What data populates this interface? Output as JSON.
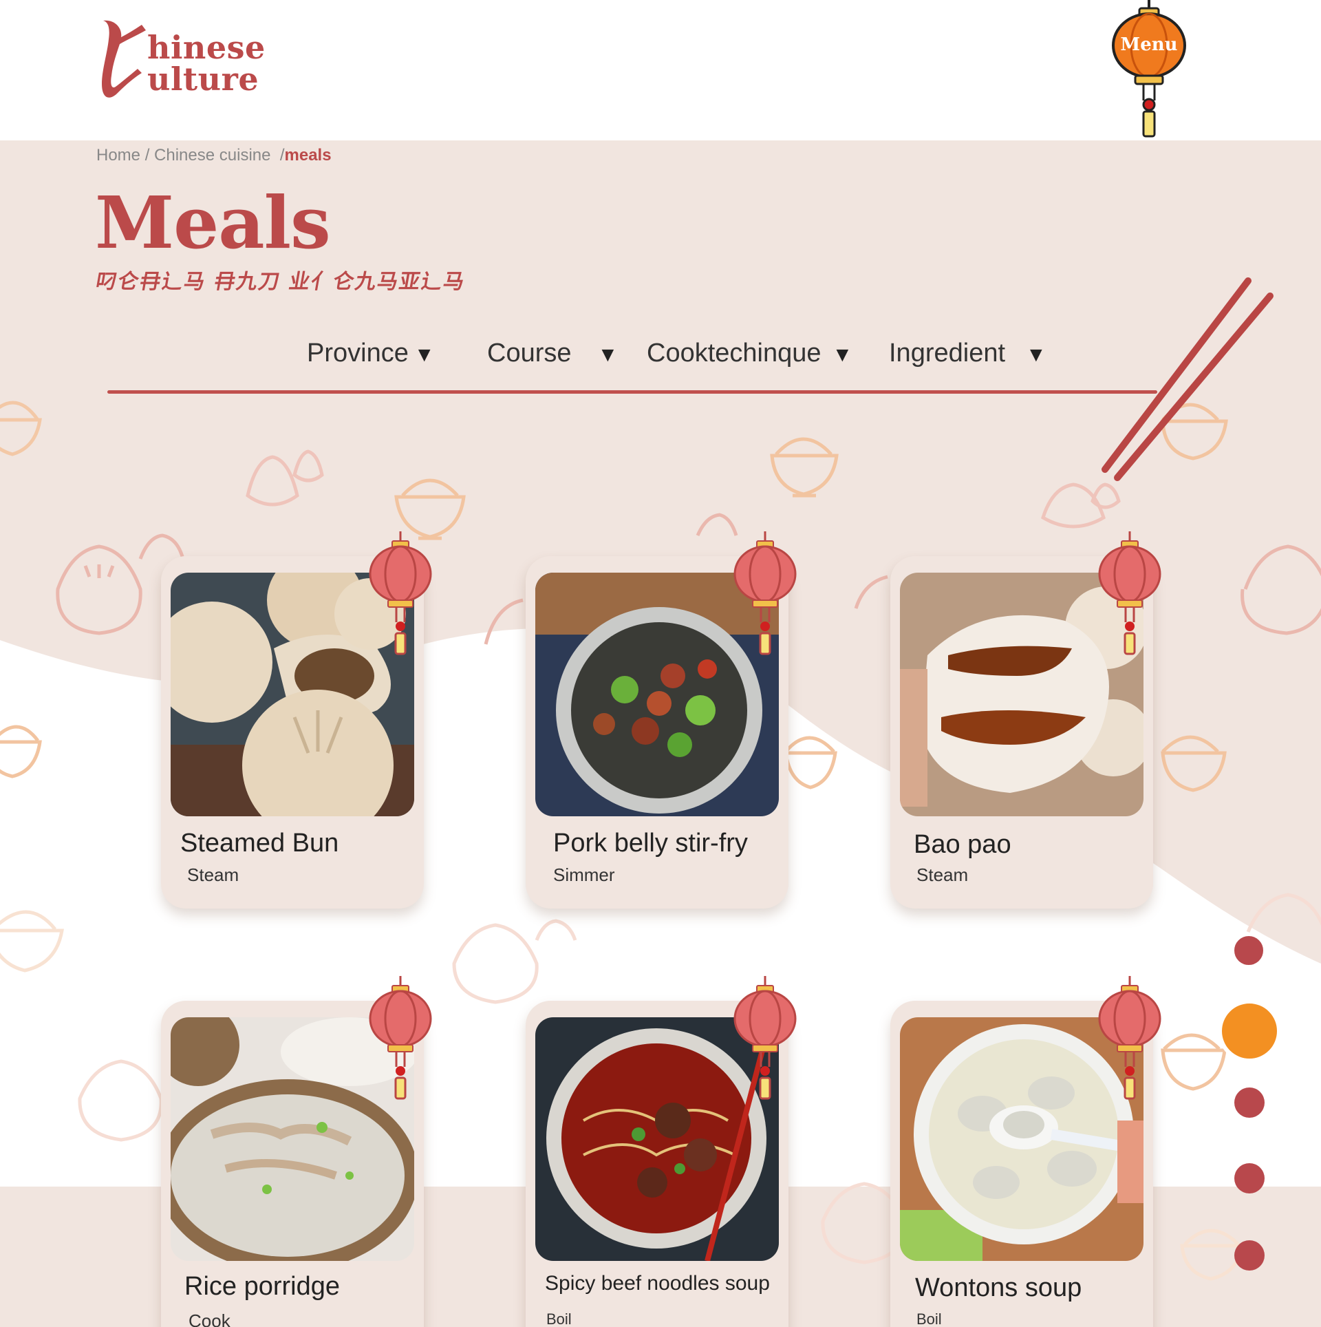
{
  "header": {
    "logo_line1": "hinese",
    "logo_line2": "ulture",
    "menu_label": "Menu"
  },
  "breadcrumb": {
    "home": "Home",
    "sep1": " / ",
    "section": "Chinese cuisine",
    "sep2": "  /",
    "current": "meals"
  },
  "page": {
    "title": "Meals",
    "subtitle": "叼仑冄辶马 冄九刀 业亻仑九马亚辶马"
  },
  "filters": [
    {
      "label": "Province",
      "arrow": "▼"
    },
    {
      "label": "Course",
      "arrow": "▼"
    },
    {
      "label": "Cooktechinque",
      "arrow": "▼"
    },
    {
      "label": "Ingredient",
      "arrow": "▼"
    }
  ],
  "cards": [
    {
      "name": "Steamed Bun",
      "method": "Steam"
    },
    {
      "name": "Pork belly stir-fry",
      "method": "Simmer"
    },
    {
      "name": "Bao pao",
      "method": "Steam"
    },
    {
      "name": "Rice porridge",
      "method": "Cook"
    },
    {
      "name": "Spicy beef noodles soup",
      "method": "Boil"
    },
    {
      "name": "Wontons soup",
      "method": "Boil"
    }
  ],
  "pager": {
    "active_index": 1,
    "count": 5
  },
  "colors": {
    "brand_red": "#bb4a4a",
    "beige": "#f1e5df",
    "active_dot": "#f39022",
    "dot": "#b8484c"
  }
}
